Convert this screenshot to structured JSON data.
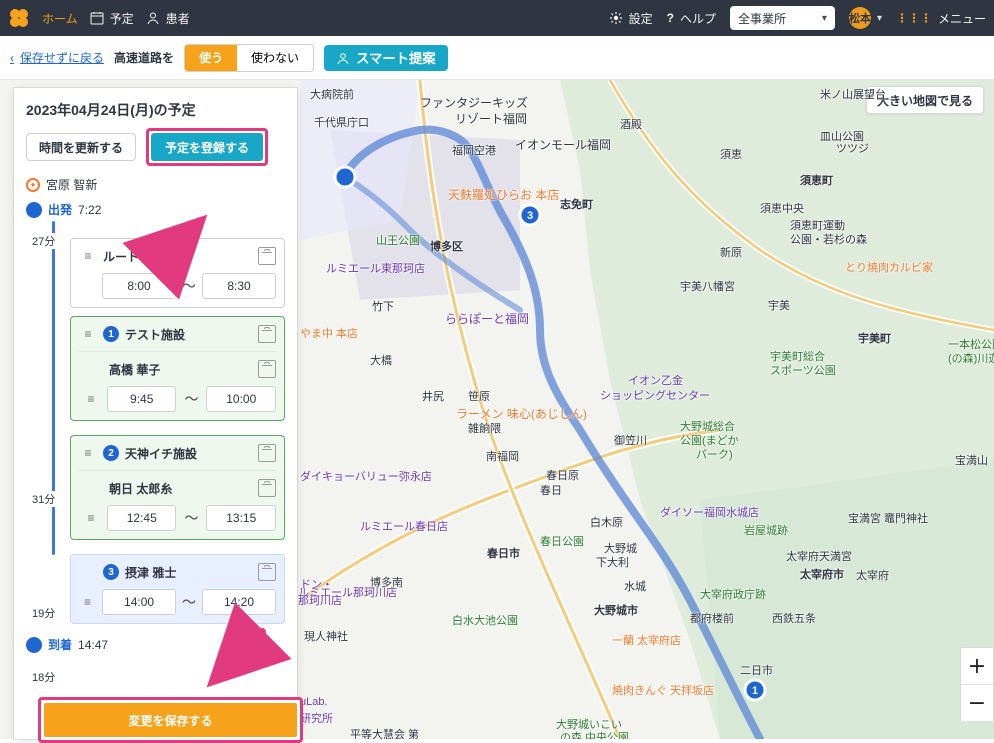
{
  "topbar": {
    "nav": [
      {
        "label": "ホーム",
        "icon": "home-icon",
        "active": true
      },
      {
        "label": "予定",
        "icon": "calendar-icon",
        "active": false
      },
      {
        "label": "患者",
        "icon": "person-icon",
        "active": false
      }
    ],
    "right": {
      "settings_label": "設定",
      "help_label": "ヘルプ",
      "office_select_value": "全事業所",
      "user_name": "松本",
      "menu_label": "メニュー"
    }
  },
  "subbar": {
    "back_label": "保存せずに戻る",
    "highway_label": "高速道路を",
    "highway_options": [
      {
        "label": "使う",
        "on": true
      },
      {
        "label": "使わない",
        "on": false
      }
    ],
    "smart_suggest_label": "スマート提案"
  },
  "panel": {
    "date_title": "2023年04月24日(月)の予定",
    "update_time_button": "時間を更新する",
    "register_button": "予定を登録する",
    "staff_name": "宮原 智新",
    "start": {
      "label": "出発",
      "time": "7:22"
    },
    "durations": [
      "27分",
      "31分",
      "19分",
      "18分"
    ],
    "items": [
      {
        "type": "memo",
        "title": "ルートメモ",
        "start": "8:00",
        "end": "8:30",
        "style": "plain"
      },
      {
        "type": "facility",
        "pin": "1",
        "title": "テスト施設",
        "style": "green",
        "sub": {
          "name": "高橋 華子",
          "start": "9:45",
          "end": "10:00"
        }
      },
      {
        "type": "facility",
        "pin": "2",
        "title": "天神イチ施設",
        "style": "green",
        "sub": {
          "name": "朝日 太郎糸",
          "start": "12:45",
          "end": "13:15"
        }
      },
      {
        "type": "patient",
        "pin": "3",
        "title": "摂津 雅士",
        "style": "blue",
        "start": "14:00",
        "end": "14:20"
      }
    ],
    "arrival": {
      "label": "到着",
      "time": "14:47"
    },
    "save_button": "変更を保存する"
  },
  "map": {
    "big_map_button": "大きい地図で見る",
    "labels": [
      {
        "text": "大病院前"
      },
      {
        "text": "ファンタジーキッズ"
      },
      {
        "text": "リゾート福岡"
      },
      {
        "text": "千代県庁口"
      },
      {
        "text": "福岡空港"
      },
      {
        "text": "イオンモール福岡"
      },
      {
        "text": "酒殿"
      },
      {
        "text": "須恵"
      },
      {
        "text": "米ノ山展望台"
      },
      {
        "text": "皿山公園"
      },
      {
        "text": "ツツジ"
      },
      {
        "text": "須恵町"
      },
      {
        "text": "天麩羅処ひらお 本店"
      },
      {
        "text": "志免町"
      },
      {
        "text": "須恵中央"
      },
      {
        "text": "須恵町運動"
      },
      {
        "text": "公園・若杉の森"
      },
      {
        "text": "とり焼肉カルビ家"
      },
      {
        "text": "山王公園"
      },
      {
        "text": "博多区"
      },
      {
        "text": "ルミエール東那珂店"
      },
      {
        "text": "宇美八幡宮"
      },
      {
        "text": "新原"
      },
      {
        "text": "宇美"
      },
      {
        "text": "ららぽーと福岡"
      },
      {
        "text": "竹下"
      },
      {
        "text": "やま中 本店"
      },
      {
        "text": "宇美町"
      },
      {
        "text": "宇美町総合"
      },
      {
        "text": "スポーツ公園"
      },
      {
        "text": "一本松公園"
      },
      {
        "text": "(の森)川遊"
      },
      {
        "text": "大橋"
      },
      {
        "text": "井尻"
      },
      {
        "text": "笹原"
      },
      {
        "text": "ラーメン 味心(あじしん)"
      },
      {
        "text": "雑餉隈"
      },
      {
        "text": "イオン乙金"
      },
      {
        "text": "ショッピングセンター"
      },
      {
        "text": "御笠川"
      },
      {
        "text": "大野城総合"
      },
      {
        "text": "公園(まどか"
      },
      {
        "text": "パーク)"
      },
      {
        "text": "宝満山"
      },
      {
        "text": "南福岡"
      },
      {
        "text": "春日原"
      },
      {
        "text": "ダイキョーバリュー弥永店"
      },
      {
        "text": "春日"
      },
      {
        "text": "白木原"
      },
      {
        "text": "ダイソー福岡水城店"
      },
      {
        "text": "岩屋城跡"
      },
      {
        "text": "宝満宮 竈門神社"
      },
      {
        "text": "ルミエール春日店"
      },
      {
        "text": "春日市"
      },
      {
        "text": "春日公園"
      },
      {
        "text": "大野城"
      },
      {
        "text": "下大利"
      },
      {
        "text": "太宰府天満宮"
      },
      {
        "text": "太宰府市"
      },
      {
        "text": "太宰府"
      },
      {
        "text": "水城"
      },
      {
        "text": "大宰府政庁跡"
      },
      {
        "text": "博多南"
      },
      {
        "text": "大野城市"
      },
      {
        "text": "都府楼前"
      },
      {
        "text": "西鉄五条"
      },
      {
        "text": "白水大池公園"
      },
      {
        "text": "一蘭 太宰府店"
      },
      {
        "text": "現人神社"
      },
      {
        "text": "二日市"
      },
      {
        "text": "焼肉きんぐ 天拝坂店"
      },
      {
        "text": "大野城いこい"
      },
      {
        "text": "の森 中央公園"
      },
      {
        "text": "平等大慧会 第"
      },
      {
        "text": "ルミエール那珂川店"
      },
      {
        "text": "ドン・"
      },
      {
        "text": "那珂川店"
      },
      {
        "text": "uLab."
      },
      {
        "text": "研究所"
      }
    ]
  },
  "colors": {
    "accent": "#f7a21b",
    "teal": "#19a7c8",
    "highlight": "#e23a7f",
    "route": "#5a86d6"
  }
}
